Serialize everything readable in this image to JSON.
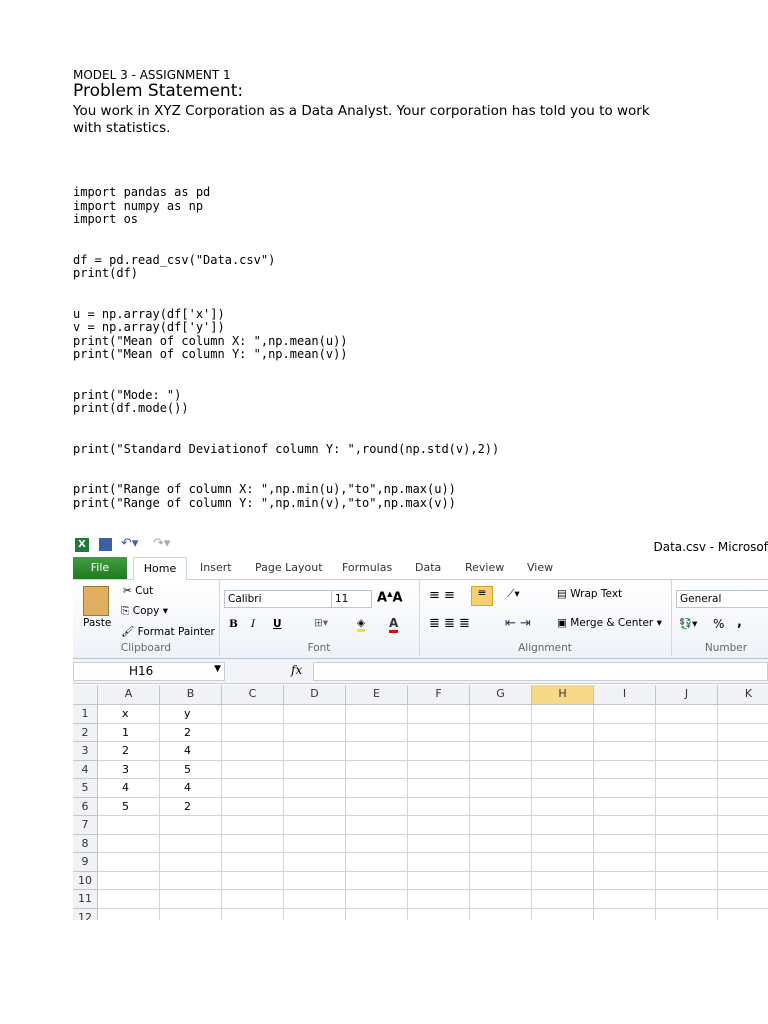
{
  "doc": {
    "model": "MODEL 3 - ASSIGNMENT 1",
    "heading": "Problem Statement:",
    "intro": "You work in XYZ Corporation as a Data Analyst. Your corporation has told you to work with statistics.",
    "code": "import pandas as pd\nimport numpy as np\nimport os\n\n\ndf = pd.read_csv(\"Data.csv\")\nprint(df)\n\n\nu = np.array(df['x'])\nv = np.array(df['y'])\nprint(\"Mean of column X: \",np.mean(u))\nprint(\"Mean of column Y: \",np.mean(v))\n\n\nprint(\"Mode: \")\nprint(df.mode())\n\n\nprint(\"Standard Deviationof column Y: \",round(np.std(v),2))\n\n\nprint(\"Range of column X: \",np.min(u),\"to\",np.max(u))\nprint(\"Range of column Y: \",np.min(v),\"to\",np.max(v))"
  },
  "excel": {
    "title": "Data.csv - Microsof",
    "tabs": [
      "File",
      "Home",
      "Insert",
      "Page Layout",
      "Formulas",
      "Data",
      "Review",
      "View"
    ],
    "clipboard": {
      "paste": "Paste",
      "cut": "Cut",
      "copy": "Copy",
      "format_painter": "Format Painter",
      "label": "Clipboard"
    },
    "font": {
      "name": "Calibri",
      "size": "11",
      "bold": "B",
      "italic": "I",
      "underline": "U",
      "label": "Font"
    },
    "alignment": {
      "wrap": "Wrap Text",
      "merge": "Merge & Center",
      "label": "Alignment"
    },
    "number": {
      "format": "General",
      "percent": "%",
      "comma": ",",
      "label": "Number"
    },
    "name_box": "H16",
    "fx": "fx",
    "columns": [
      "A",
      "B",
      "C",
      "D",
      "E",
      "F",
      "G",
      "H",
      "I",
      "J",
      "K"
    ],
    "selected_column": "H",
    "rows": [
      [
        "x",
        "y"
      ],
      [
        "1",
        "2"
      ],
      [
        "2",
        "4"
      ],
      [
        "3",
        "5"
      ],
      [
        "4",
        "4"
      ],
      [
        "5",
        "2"
      ],
      [],
      [],
      [],
      [],
      [],
      []
    ]
  }
}
